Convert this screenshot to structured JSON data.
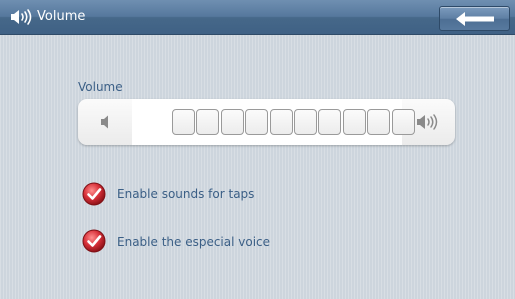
{
  "window": {
    "title": "Volume",
    "back_icon": "back-arrow-icon",
    "title_icon": "speaker-icon"
  },
  "volume": {
    "label": "Volume",
    "level_filled": 0,
    "segment_count": 10,
    "down_icon": "volume-down-icon",
    "up_icon": "volume-up-icon"
  },
  "options": [
    {
      "label": "Enable sounds for taps",
      "checked": true,
      "icon": "checkmark-icon"
    },
    {
      "label": "Enable the especial voice",
      "checked": true,
      "icon": "checkmark-icon"
    }
  ],
  "colors": {
    "titlebar": "#4a6d92",
    "text": "#3b5f86",
    "check": "#c0282e"
  }
}
